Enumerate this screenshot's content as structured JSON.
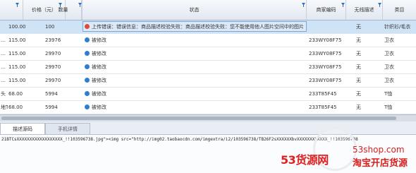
{
  "columns": {
    "price": "价格（元）",
    "qty": "数量",
    "status": "状态",
    "merchant_code": "商家编码",
    "no_fail_desc": "无线描述",
    "category": "类目"
  },
  "rows": [
    {
      "prefix": "",
      "price": "100.00",
      "qty": "100",
      "status_type": "error",
      "status": "上传错误：错误信息：商品描述校验失败：商品描述校验失败：您不能使用他人图片空间中的图片",
      "code": "",
      "wireless": "无",
      "category": "针织衫/毛衣"
    },
    {
      "prefix": "…",
      "price": "115.00",
      "qty": "23976",
      "status_type": "info",
      "status": "被修改",
      "code": "233WY08F75",
      "wireless": "无",
      "category": "卫衣"
    },
    {
      "prefix": "…",
      "price": "115.00",
      "qty": "29970",
      "status_type": "info",
      "status": "被修改",
      "code": "233WY08F75",
      "wireless": "无",
      "category": "卫衣"
    },
    {
      "prefix": "…",
      "price": "115.00",
      "qty": "29970",
      "status_type": "info",
      "status": "被修改",
      "code": "233WY08F75",
      "wireless": "无",
      "category": "卫衣"
    },
    {
      "prefix": "…",
      "price": "115.00",
      "qty": "29970",
      "status_type": "info",
      "status": "被修改",
      "code": "233WY08F75",
      "wireless": "无",
      "category": "卫衣"
    },
    {
      "prefix": "头",
      "price": "68.00",
      "qty": "5994",
      "status_type": "info",
      "status": "被修改",
      "code": "233T85F45",
      "wireless": "无",
      "category": "T恤"
    },
    {
      "prefix": "地T",
      "price": "68.00",
      "qty": "5994",
      "status_type": "info",
      "status": "被修改",
      "code": "233T85F45",
      "wireless": "无",
      "category": "T恤"
    },
    {
      "prefix": "…",
      "price": "68.00",
      "qty": "5994",
      "status_type": "info",
      "status": "被修改",
      "code": "233T85F45",
      "wireless": "无",
      "category": "T恤"
    }
  ],
  "tabs": [
    "描述源码",
    "手机详情"
  ],
  "code_text": "21BTCsXXXXXXXXXXXXXXXXXX_!!103596738.jpg\"><img src=\"http://img02.taobaocdn.com/imgextra/i2/103596738/TB26F2sXXXXXXbvXXXXXXXXXXXX_!!103596738",
  "watermark": {
    "brand": "53货源网",
    "site": "53shop.com",
    "slogan": "淘宝开店货源"
  },
  "colors": {
    "selected_row": "#cfe3f7",
    "error_icon": "#e04a3a",
    "info_icon": "#2f7dd0",
    "watermark_red": "#e02020"
  }
}
